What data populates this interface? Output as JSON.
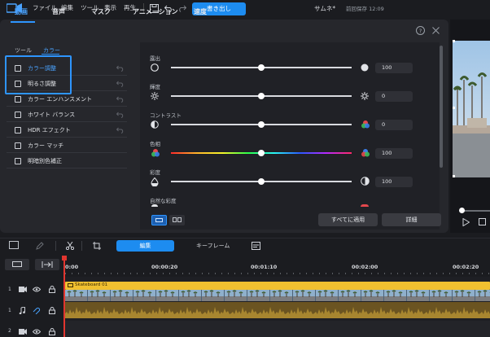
{
  "menu": {
    "file": "ファイル",
    "edit": "編集",
    "tools": "ツール",
    "view": "表示",
    "play": "再生",
    "export": "書き出し",
    "project_title": "サムネ*",
    "save_status": "前回保存 12:09"
  },
  "tabs": {
    "video": "動画",
    "audio": "音声",
    "mask": "マスク",
    "animation": "アニメーション",
    "speed": "速度"
  },
  "subtabs": {
    "tool": "ツール",
    "color": "カラー"
  },
  "options": [
    "カラー調整",
    "明るさ調整",
    "カラー エンハンスメント",
    "ホワイト バランス",
    "HDR エフェクト",
    "カラー マッチ",
    "明暗別色補正"
  ],
  "sliders": [
    {
      "label": "露出",
      "value": "100",
      "level": 0.5
    },
    {
      "label": "輝度",
      "value": "0",
      "level": 0.5
    },
    {
      "label": "コントラスト",
      "value": "0",
      "level": 0.5
    },
    {
      "label": "色相",
      "value": "100",
      "level": 0.5
    },
    {
      "label": "彩度",
      "value": "100",
      "level": 0.5
    },
    {
      "label": "自然な彩度",
      "value": "",
      "level": 0.5
    }
  ],
  "buttons": {
    "apply_all": "すべてに適用",
    "detail": "詳細"
  },
  "timeline": {
    "edit_tab": "編集",
    "keyframe_tab": "キーフレーム",
    "ruler": [
      "0:00",
      "00:00:20",
      "00:01:10",
      "00:02:00",
      "00:02:20"
    ],
    "clip_name": "Skateboard 01",
    "tracks": [
      "1",
      "1",
      "2"
    ]
  },
  "colors": {
    "accent": "#1d8cf0",
    "clip_video": "#f0c030",
    "playhead": "#e2352f"
  }
}
